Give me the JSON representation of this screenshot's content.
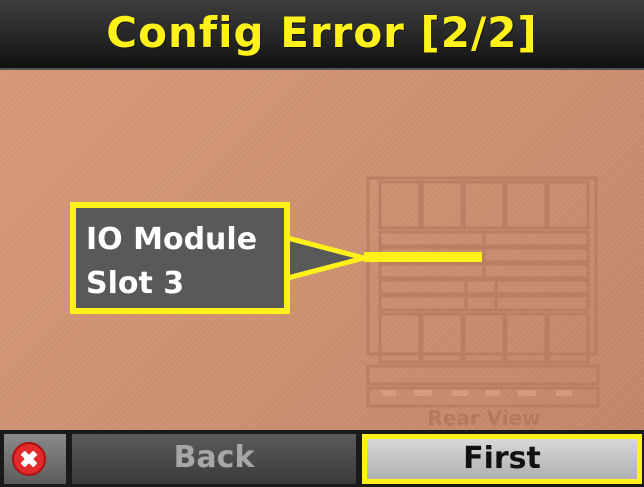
{
  "header": {
    "title": "Config Error [2/2]"
  },
  "callout": {
    "line1": "IO Module",
    "line2": "Slot 3"
  },
  "diagram": {
    "caption": "Rear View"
  },
  "footer": {
    "close_icon": "close-icon",
    "back_label": "Back",
    "first_label": "First"
  },
  "colors": {
    "accent_yellow": "#fff21a",
    "background": "#d4977a",
    "callout_fill": "#595959",
    "close_red": "#e22a2a"
  }
}
